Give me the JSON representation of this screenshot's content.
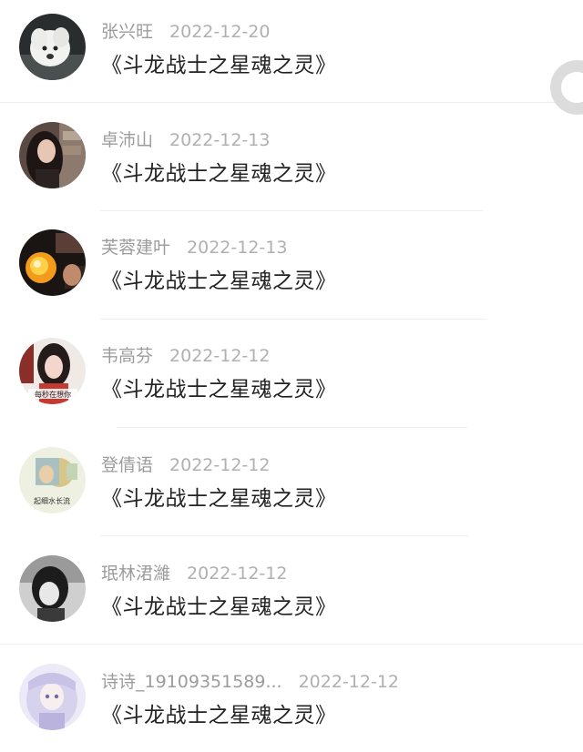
{
  "comments": [
    {
      "user": "张兴旺",
      "date": "2022-12-20",
      "text": "《斗龙战士之星魂之灵》",
      "avatar_icon": "white-dog-avatar"
    },
    {
      "user": "卓沛山",
      "date": "2022-12-13",
      "text": "《斗龙战士之星魂之灵》",
      "avatar_icon": "girl-portrait-avatar"
    },
    {
      "user": "芙蓉建叶",
      "date": "2022-12-13",
      "text": "《斗龙战士之星魂之灵》",
      "avatar_icon": "glowing-orb-avatar"
    },
    {
      "user": "韦高芬",
      "date": "2022-12-12",
      "text": "《斗龙战士之星魂之灵》",
      "avatar_icon": "girl-with-caption-avatar",
      "avatar_caption": "每秒在想你"
    },
    {
      "user": "登倩语",
      "date": "2022-12-12",
      "text": "《斗龙战士之星魂之灵》",
      "avatar_icon": "illustration-avatar",
      "avatar_caption": "起细水长流"
    },
    {
      "user": "珉林涒濰",
      "date": "2022-12-12",
      "text": "《斗龙战士之星魂之灵》",
      "avatar_icon": "bw-portrait-avatar"
    },
    {
      "user": "诗诗_19109351589...",
      "date": "2022-12-12",
      "text": "《斗龙战士之星魂之灵》",
      "avatar_icon": "anime-girl-avatar"
    }
  ],
  "side_handle_icon": "floating-circle-button"
}
